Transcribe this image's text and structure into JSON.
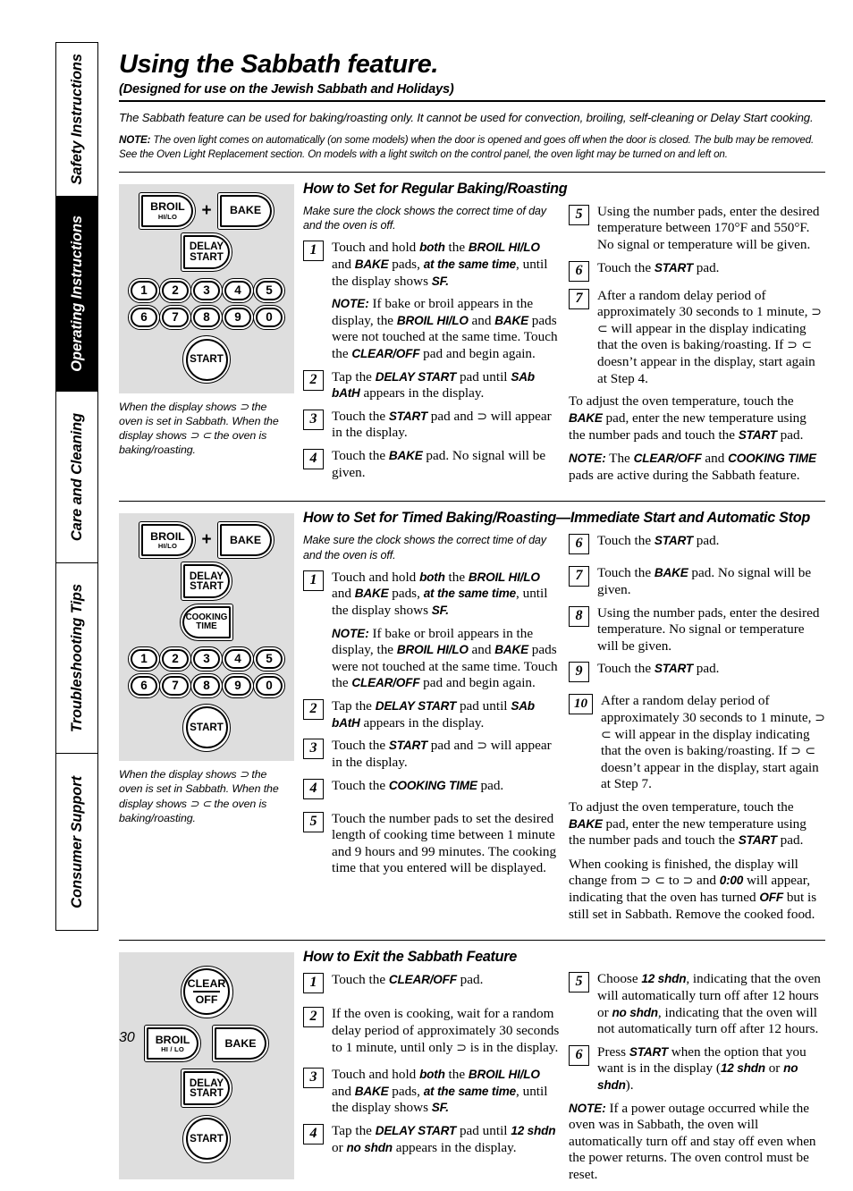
{
  "sidebar": {
    "tabs": [
      {
        "label": "Safety Instructions",
        "active": false
      },
      {
        "label": "Operating Instructions",
        "active": true
      },
      {
        "label": "Care and Cleaning",
        "active": false
      },
      {
        "label": "Troubleshooting Tips",
        "active": false
      },
      {
        "label": "Consumer Support",
        "active": false
      }
    ]
  },
  "page": {
    "title": "Using the Sabbath feature.",
    "subtitle": "(Designed for use on the Jewish Sabbath and Holidays)",
    "intro": "The Sabbath feature can be used for baking/roasting only. It cannot be used for convection, broiling, self-cleaning or Delay Start cooking.",
    "note_label": "NOTE:",
    "note_text": "The oven light comes on automatically (on some models) when the door is opened and goes off when the door is closed. The bulb may be removed. See the Oven Light Replacement section. On models with a light switch on the control panel, the oven light may be turned on and left on.",
    "page_number": "30"
  },
  "pads": {
    "broil": "BROIL",
    "broil_sub": "HI/LO",
    "broil_sub_alt": "HI / LO",
    "bake": "BAKE",
    "plus": "+",
    "delay_line1": "DELAY",
    "delay_line2": "START",
    "cooking_line1": "COOKING",
    "cooking_line2": "TIME",
    "start": "START",
    "clear_line1": "CLEAR",
    "clear_line2": "OFF",
    "numbers_row1": [
      "1",
      "2",
      "3",
      "4",
      "5"
    ],
    "numbers_row2": [
      "6",
      "7",
      "8",
      "9",
      "0"
    ]
  },
  "caption": {
    "text": "When the display shows ⊃ the oven is set in Sabbath. When the display shows ⊃ ⊂ the oven is baking/roasting."
  },
  "section1": {
    "title": "How to Set for Regular Baking/Roasting",
    "lead": "Make sure the clock shows the correct time of day and the oven is off.",
    "steps": [
      {
        "num": "1",
        "text": "Touch and hold both the BROIL HI/LO and BAKE pads, at the same time, until the display shows SF."
      },
      {
        "num": "2",
        "text": "Tap the DELAY START pad until SAb bAtH appears in the display."
      },
      {
        "num": "3",
        "text": "Touch the START pad and ⊃ will appear in the display."
      },
      {
        "num": "4",
        "text": "Touch the BAKE pad. No signal will be given."
      },
      {
        "num": "5",
        "text": "Using the number pads, enter the desired temperature between 170°F and 550°F. No signal or temperature will be given."
      },
      {
        "num": "6",
        "text": "Touch the START pad."
      },
      {
        "num": "7",
        "text": "After a random delay period of approximately 30 seconds to 1 minute, ⊃ ⊂ will appear in the display indicating that the oven is baking/roasting. If ⊃ ⊂ doesn't appear in the display, start again at Step 4."
      }
    ],
    "step1_note_label": "NOTE:",
    "step1_note": "If bake or broil appears in the display, the BROIL HI/LO and BAKE pads were not touched at the same time. Touch the CLEAR/OFF pad and begin again.",
    "adjust_text": "To adjust the oven temperature, touch the BAKE pad, enter the new temperature using the number pads and touch the START pad.",
    "end_note_label": "NOTE:",
    "end_note": "The CLEAR/OFF and COOKING TIME pads are active during the Sabbath feature."
  },
  "section2": {
    "title": "How to Set for Timed Baking/Roasting—Immediate Start and Automatic Stop",
    "lead": "Make sure the clock shows the correct time of day and the oven is off.",
    "steps": [
      {
        "num": "1",
        "text": "Touch and hold both the BROIL HI/LO and BAKE pads, at the same time, until the display shows SF."
      },
      {
        "num": "2",
        "text": "Tap the DELAY START pad until SAb bAtH appears in the display."
      },
      {
        "num": "3",
        "text": "Touch the START pad and ⊃ will appear in the display."
      },
      {
        "num": "4",
        "text": "Touch the COOKING TIME pad."
      },
      {
        "num": "5",
        "text": "Touch the number pads to set the desired length of cooking time between 1 minute and 9 hours and 99 minutes. The cooking time that you entered will be displayed."
      },
      {
        "num": "6",
        "text": "Touch the START pad."
      },
      {
        "num": "7",
        "text": "Touch the BAKE pad. No signal will be given."
      },
      {
        "num": "8",
        "text": "Using the number pads, enter the desired temperature. No signal or temperature will be given."
      },
      {
        "num": "9",
        "text": "Touch the START pad."
      },
      {
        "num": "10",
        "text": "After a random delay period of approximately 30 seconds to 1 minute, ⊃ ⊂ will appear in the display indicating that the oven is baking/roasting. If ⊃ ⊂ doesn't appear in the display, start again at Step 7."
      }
    ],
    "step1_note_label": "NOTE:",
    "step1_note": "If bake or broil appears in the display, the BROIL HI/LO and BAKE pads were not touched at the same time. Touch the CLEAR/OFF pad and begin again.",
    "adjust_text": "To adjust the oven temperature, touch the BAKE pad, enter the new temperature using the number pads and touch the START pad.",
    "finish_text": "When cooking is finished, the display will change from ⊃ ⊂ to ⊃ and 0:00 will appear, indicating that the oven has turned OFF but is still set in Sabbath. Remove the cooked food."
  },
  "section3": {
    "title": "How to Exit the Sabbath Feature",
    "steps": [
      {
        "num": "1",
        "text": "Touch the CLEAR/OFF pad."
      },
      {
        "num": "2",
        "text": "If the oven is cooking, wait for a random delay period of approximately 30 seconds to 1 minute, until only ⊃ is in the display."
      },
      {
        "num": "3",
        "text": "Touch and hold both the BROIL HI/LO and BAKE pads, at the same time, until the display shows SF."
      },
      {
        "num": "4",
        "text": "Tap the DELAY START pad until 12 shdn or no shdn appears in the display."
      },
      {
        "num": "5",
        "text": "Choose 12 shdn, indicating that the oven will automatically turn off after 12 hours or no shdn, indicating that the oven will not automatically turn off after 12 hours."
      },
      {
        "num": "6",
        "text": "Press START when the option that you want is in the display (12 shdn or no shdn)."
      }
    ],
    "end_note_label": "NOTE:",
    "end_note": "If a power outage occurred while the oven was in Sabbath, the oven will automatically turn off and stay off even when the power returns. The oven control must be reset."
  }
}
